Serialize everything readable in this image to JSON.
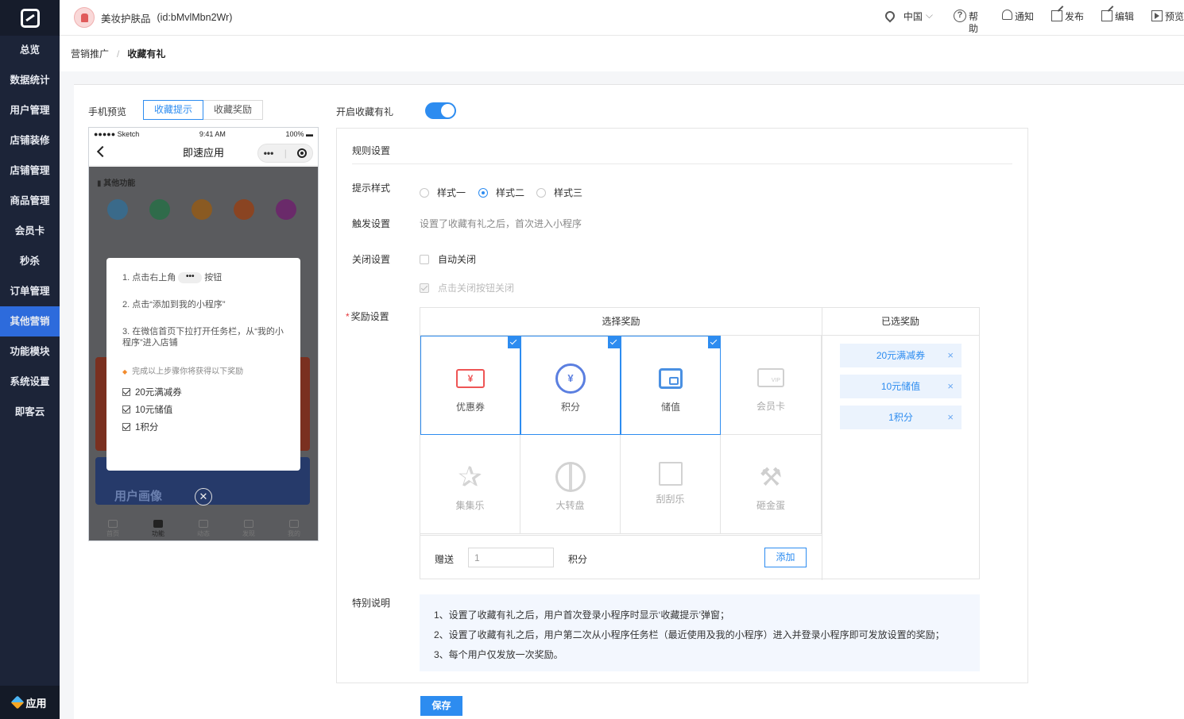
{
  "sidebar": {
    "items": [
      {
        "label": "总览",
        "active": false
      },
      {
        "label": "数据统计",
        "active": false
      },
      {
        "label": "用户管理",
        "active": false
      },
      {
        "label": "店铺装修",
        "active": false
      },
      {
        "label": "店铺管理",
        "active": false
      },
      {
        "label": "商品管理",
        "active": false
      },
      {
        "label": "会员卡",
        "active": false
      },
      {
        "label": "秒杀",
        "active": false
      },
      {
        "label": "订单管理",
        "active": false
      },
      {
        "label": "其他营销",
        "active": true
      },
      {
        "label": "功能模块",
        "active": false
      },
      {
        "label": "系统设置",
        "active": false
      },
      {
        "label": "即客云",
        "active": false
      }
    ],
    "app_label": "应用"
  },
  "topbar": {
    "store_name": "美妆护肤品",
    "store_id": "(id:bMvlMbn2Wr)",
    "region": "中国",
    "help": "帮助",
    "notify": "通知",
    "publish": "发布",
    "edit": "编辑",
    "preview": "预览"
  },
  "breadcrumb": {
    "parent": "营销推广",
    "sep": "/",
    "current": "收藏有礼"
  },
  "preview": {
    "label": "手机预览",
    "tabs": [
      {
        "label": "收藏提示",
        "active": true
      },
      {
        "label": "收藏奖励",
        "active": false
      }
    ],
    "phone": {
      "carrier": "●●●●● Sketch",
      "time": "9:41 AM",
      "battery": "100%",
      "title": "即速应用",
      "capsule_dots": "•••",
      "bg_section": "▮ 其他功能",
      "bg_banner": "用户画像",
      "bg_tabs": [
        "首页",
        "功能",
        "动态",
        "发现",
        "我的"
      ],
      "modal": {
        "step1_pre": "1. 点击右上角",
        "step1_dots": "•••",
        "step1_post": "按钮",
        "step2": "2. 点击“添加到我的小程序”",
        "step3": "3. 在微信首页下拉打开任务栏，从“我的小程序”进入店铺",
        "tip": "完成以上步骤你将获得以下奖励",
        "gifts": [
          "20元满减券",
          "10元储值",
          "1积分"
        ]
      },
      "close_glyph": "✕"
    }
  },
  "toggle": {
    "label": "开启收藏有礼",
    "on": true
  },
  "rules": {
    "title": "规则设置",
    "style_label": "提示样式",
    "styles": [
      {
        "label": "样式一",
        "checked": false
      },
      {
        "label": "样式二",
        "checked": true
      },
      {
        "label": "样式三",
        "checked": false
      }
    ],
    "trigger_label": "触发设置",
    "trigger_text": "设置了收藏有礼之后，首次进入小程序",
    "close_label": "关闭设置",
    "auto_close": "自动关闭",
    "button_close": "点击关闭按钮关闭",
    "reward_label": "奖励设置",
    "reward_required": "*",
    "choose_header": "选择奖励",
    "selected_header": "已选奖励",
    "tiles": [
      {
        "name": "优惠券",
        "icon": "coupon-icon",
        "glyph": "¥",
        "selected": true
      },
      {
        "name": "积分",
        "icon": "points-icon",
        "glyph": "¥",
        "selected": true
      },
      {
        "name": "储值",
        "icon": "wallet-icon",
        "selected": true
      },
      {
        "name": "会员卡",
        "icon": "vip-card-icon",
        "glyph": "VIP",
        "selected": false
      },
      {
        "name": "集集乐",
        "icon": "star-icon",
        "glyph": "✰",
        "selected": false
      },
      {
        "name": "大转盘",
        "icon": "wheel-icon",
        "selected": false
      },
      {
        "name": "刮刮乐",
        "icon": "scratch-card-icon",
        "selected": false
      },
      {
        "name": "砸金蛋",
        "icon": "hammer-icon",
        "glyph": "⚒",
        "selected": false
      }
    ],
    "gift_label": "赠送",
    "gift_value": "1",
    "gift_unit": "积分",
    "add_button": "添加",
    "chips": [
      "20元满减券",
      "10元储值",
      "1积分"
    ],
    "chip_remove": "×",
    "note_label": "特别说明",
    "notes": [
      "1、设置了收藏有礼之后，用户首次登录小程序时显示‘收藏提示’弹窗；",
      "2、设置了收藏有礼之后，用户第二次从小程序任务栏（最近使用及我的小程序）进入并登录小程序即可发放设置的奖励；",
      "3、每个用户仅发放一次奖励。"
    ],
    "save_button": "保存"
  },
  "colors": {
    "primary": "#2d8cf0",
    "sidebar": "#1c2438",
    "active": "#2d6bdc"
  }
}
